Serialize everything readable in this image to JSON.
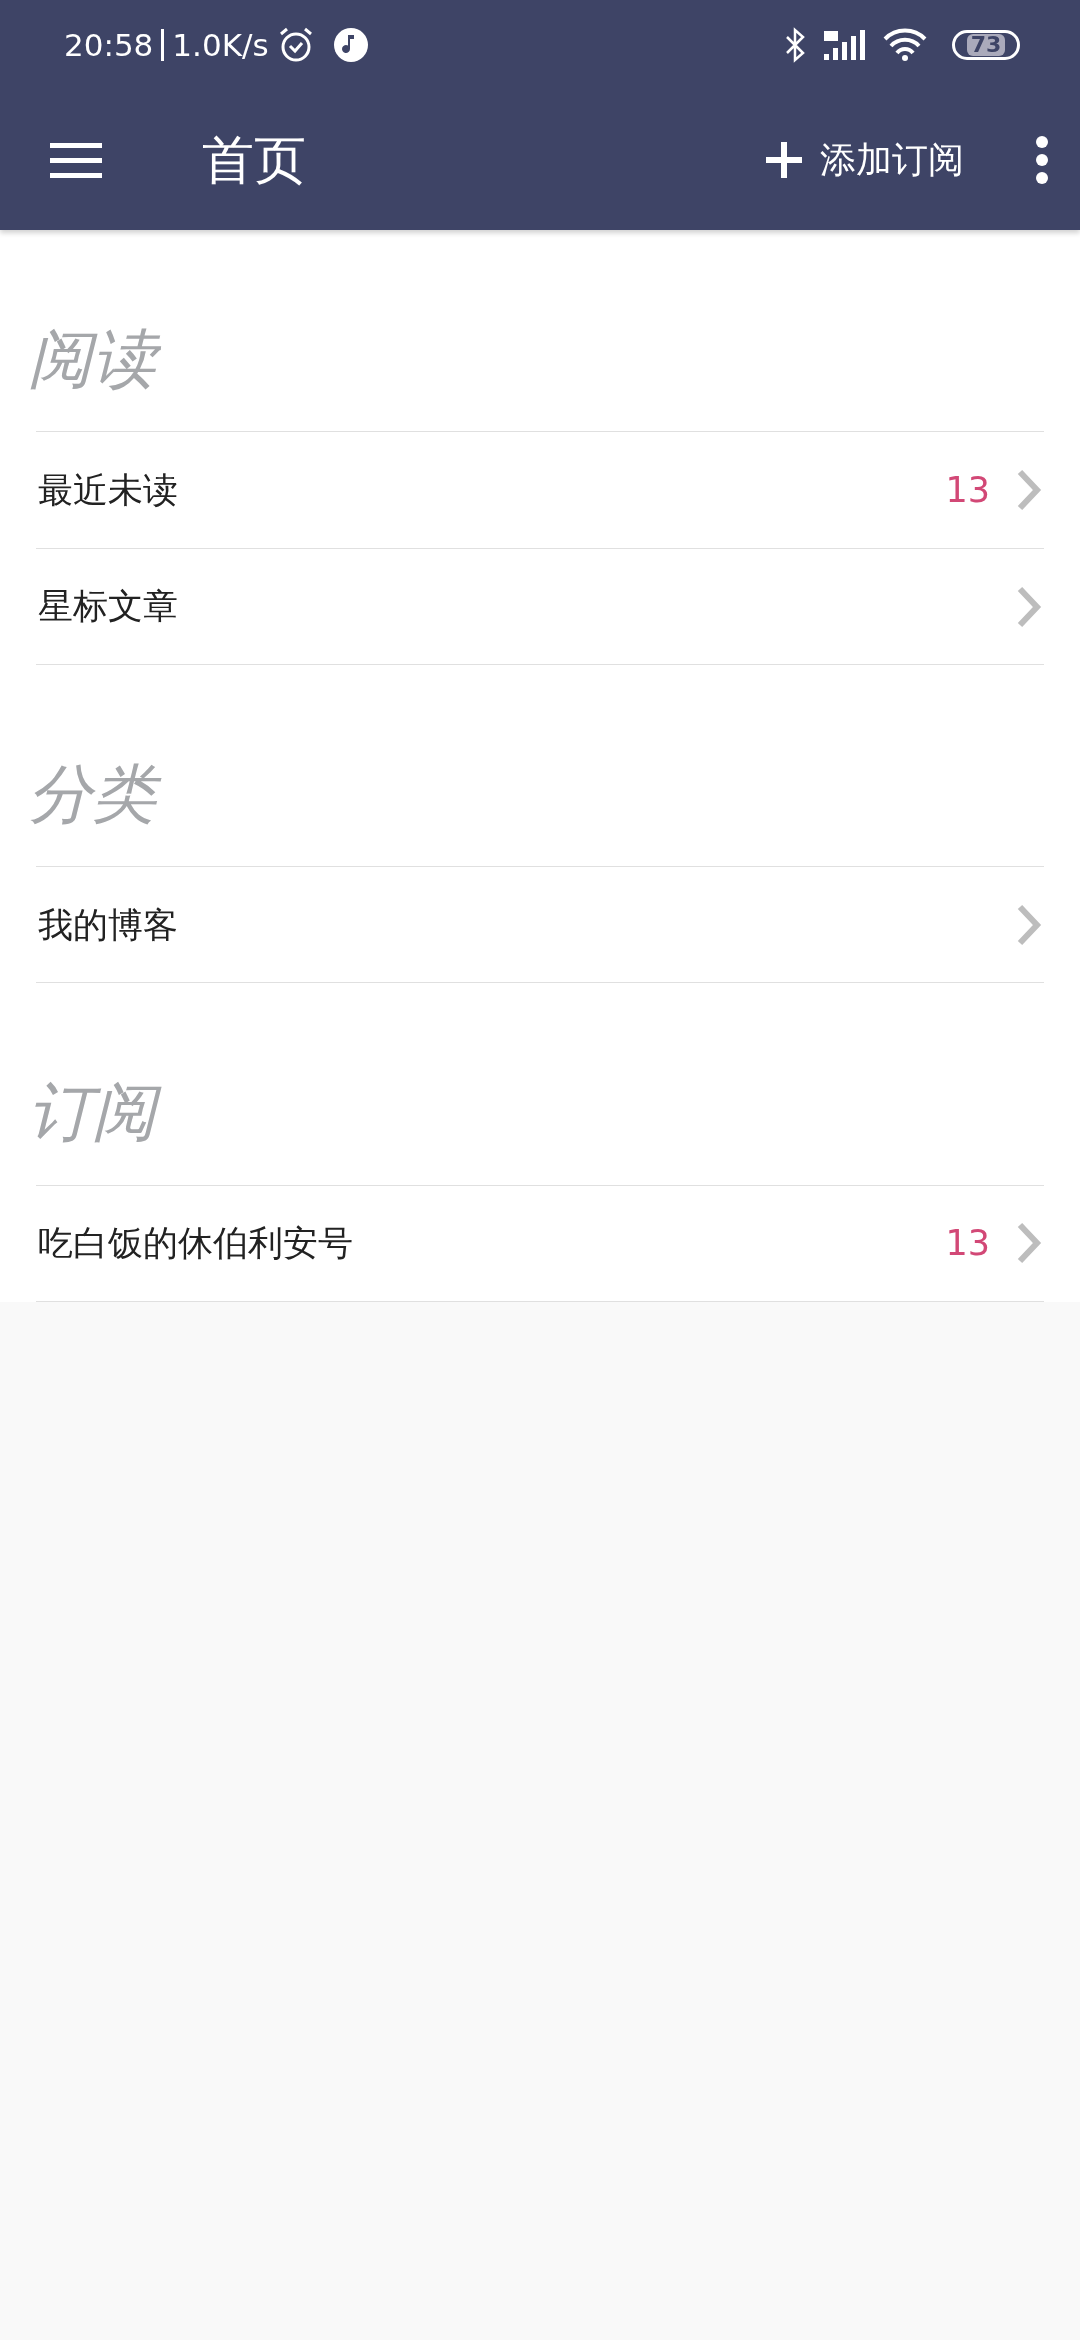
{
  "status_bar": {
    "time": "20:58",
    "speed": "1.0K/s",
    "battery": "73"
  },
  "toolbar": {
    "title": "首页",
    "action": "添加订阅"
  },
  "sections": [
    {
      "title": "阅读",
      "items": [
        {
          "label": "最近未读",
          "count": "13"
        },
        {
          "label": "星标文章"
        }
      ]
    },
    {
      "title": "分类",
      "items": [
        {
          "label": "我的博客"
        }
      ]
    },
    {
      "title": "订阅",
      "items": [
        {
          "label": "吃白饭的休伯利安号",
          "count": "13"
        }
      ]
    }
  ]
}
